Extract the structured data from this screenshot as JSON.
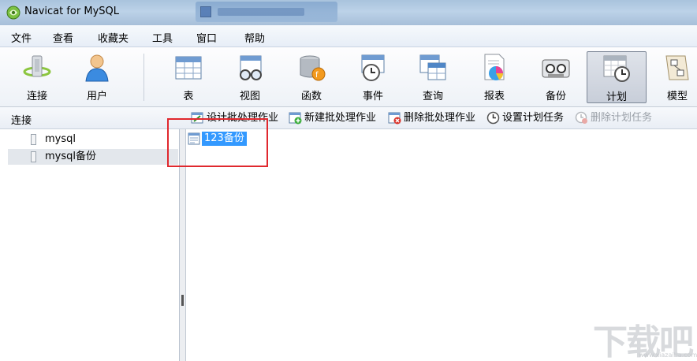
{
  "window": {
    "title": "Navicat for MySQL"
  },
  "menu": [
    "文件",
    "查看",
    "收藏夹",
    "工具",
    "窗口",
    "帮助"
  ],
  "toolbar": {
    "connect": "连接",
    "user": "用户",
    "table": "表",
    "view": "视图",
    "function": "函数",
    "event": "事件",
    "query": "查询",
    "report": "报表",
    "backup": "备份",
    "schedule": "计划",
    "model": "模型"
  },
  "subbar": {
    "header": "连接",
    "design_job": "设计批处理作业",
    "new_job": "新建批处理作业",
    "delete_job": "删除批处理作业",
    "set_schedule": "设置计划任务",
    "delete_schedule": "删除计划任务"
  },
  "connections": [
    "mysql",
    "mysql备份"
  ],
  "jobs": [
    "123备份"
  ],
  "highlight_color": "#e0282e",
  "selection_color": "#3399ff",
  "watermark": {
    "text": "下载吧",
    "sub": "www.xiazaiba.com"
  }
}
